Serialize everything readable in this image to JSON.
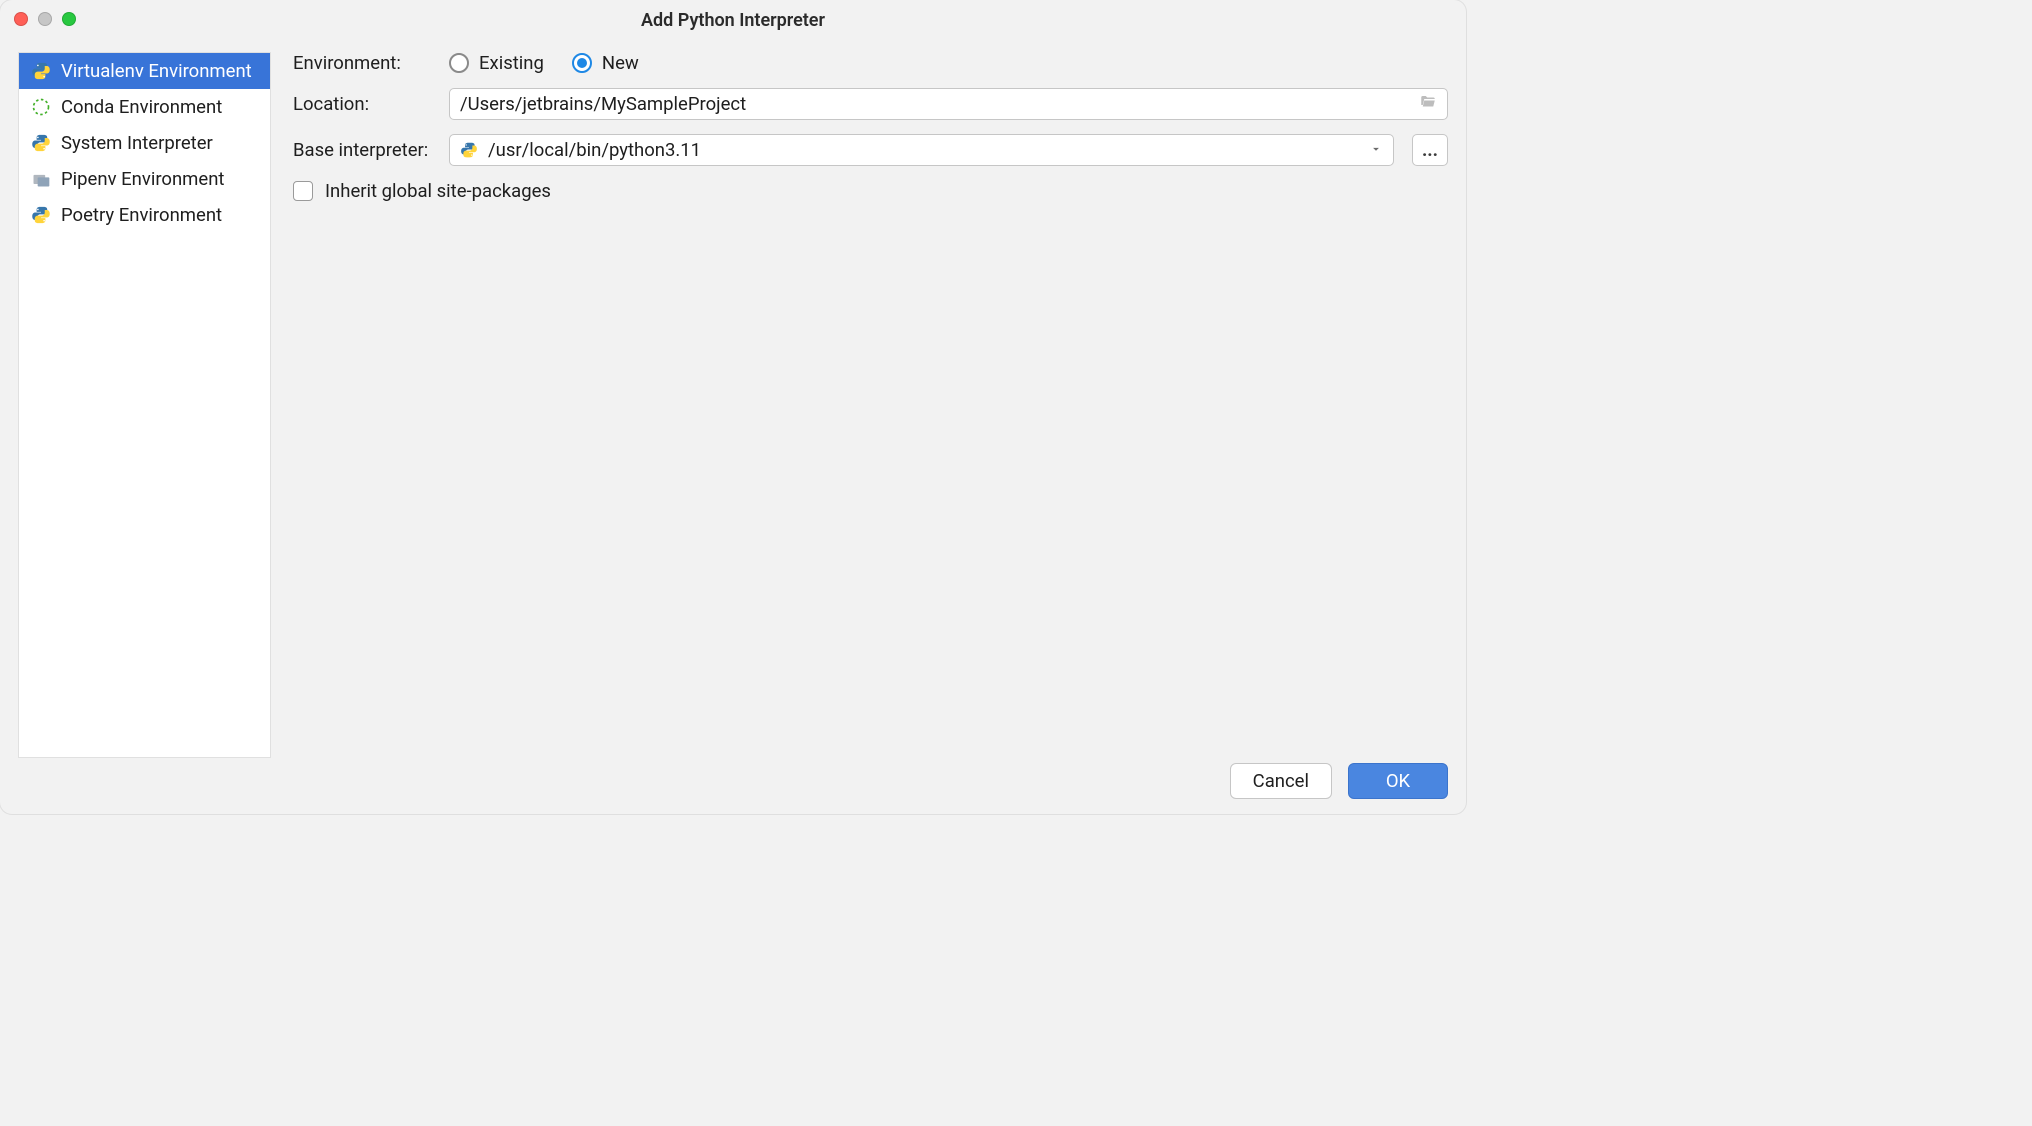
{
  "title": "Add Python Interpreter",
  "sidebar": {
    "items": [
      {
        "label": "Virtualenv Environment",
        "icon": "python-icon",
        "selected": true
      },
      {
        "label": "Conda Environment",
        "icon": "conda-icon",
        "selected": false
      },
      {
        "label": "System Interpreter",
        "icon": "python-icon",
        "selected": false
      },
      {
        "label": "Pipenv Environment",
        "icon": "pipenv-icon",
        "selected": false
      },
      {
        "label": "Poetry Environment",
        "icon": "python-icon",
        "selected": false
      }
    ]
  },
  "form": {
    "env_label": "Environment:",
    "env_options": {
      "existing": "Existing",
      "new": "New"
    },
    "env_selected": "new",
    "location_label": "Location:",
    "location_value": "/Users/jetbrains/MySampleProject",
    "base_label": "Base interpreter:",
    "base_value": "/usr/local/bin/python3.11",
    "browse_label": "...",
    "inherit_label": "Inherit global site-packages",
    "inherit_checked": false
  },
  "footer": {
    "cancel": "Cancel",
    "ok": "OK"
  }
}
